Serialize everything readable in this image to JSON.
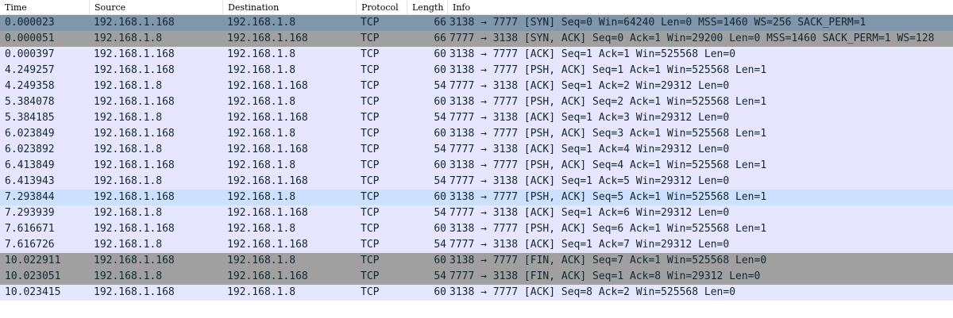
{
  "columns": {
    "time": "Time",
    "source": "Source",
    "destination": "Destination",
    "protocol": "Protocol",
    "length": "Length",
    "info": "Info"
  },
  "row_colors": {
    "default": "#e7e6ff",
    "syn_fin": "#a0a0a0",
    "selected": "#7f96ac",
    "hover": "#cde0ff"
  },
  "packets": [
    {
      "time": "0.000023",
      "source": "192.168.1.168",
      "destination": "192.168.1.8",
      "protocol": "TCP",
      "length": "66",
      "info": "3138 → 7777 [SYN] Seq=0 Win=64240 Len=0 MSS=1460 WS=256 SACK_PERM=1",
      "state": "selected"
    },
    {
      "time": "0.000051",
      "source": "192.168.1.8",
      "destination": "192.168.1.168",
      "protocol": "TCP",
      "length": "66",
      "info": "7777 → 3138 [SYN, ACK] Seq=0 Ack=1 Win=29200 Len=0 MSS=1460 SACK_PERM=1 WS=128",
      "state": "syn"
    },
    {
      "time": "0.000397",
      "source": "192.168.1.168",
      "destination": "192.168.1.8",
      "protocol": "TCP",
      "length": "60",
      "info": "3138 → 7777 [ACK] Seq=1 Ack=1 Win=525568 Len=0",
      "state": "default"
    },
    {
      "time": "4.249257",
      "source": "192.168.1.168",
      "destination": "192.168.1.8",
      "protocol": "TCP",
      "length": "60",
      "info": "3138 → 7777 [PSH, ACK] Seq=1 Ack=1 Win=525568 Len=1",
      "state": "default"
    },
    {
      "time": "4.249358",
      "source": "192.168.1.8",
      "destination": "192.168.1.168",
      "protocol": "TCP",
      "length": "54",
      "info": "7777 → 3138 [ACK] Seq=1 Ack=2 Win=29312 Len=0",
      "state": "default"
    },
    {
      "time": "5.384078",
      "source": "192.168.1.168",
      "destination": "192.168.1.8",
      "protocol": "TCP",
      "length": "60",
      "info": "3138 → 7777 [PSH, ACK] Seq=2 Ack=1 Win=525568 Len=1",
      "state": "default"
    },
    {
      "time": "5.384185",
      "source": "192.168.1.8",
      "destination": "192.168.1.168",
      "protocol": "TCP",
      "length": "54",
      "info": "7777 → 3138 [ACK] Seq=1 Ack=3 Win=29312 Len=0",
      "state": "default"
    },
    {
      "time": "6.023849",
      "source": "192.168.1.168",
      "destination": "192.168.1.8",
      "protocol": "TCP",
      "length": "60",
      "info": "3138 → 7777 [PSH, ACK] Seq=3 Ack=1 Win=525568 Len=1",
      "state": "default"
    },
    {
      "time": "6.023892",
      "source": "192.168.1.8",
      "destination": "192.168.1.168",
      "protocol": "TCP",
      "length": "54",
      "info": "7777 → 3138 [ACK] Seq=1 Ack=4 Win=29312 Len=0",
      "state": "default"
    },
    {
      "time": "6.413849",
      "source": "192.168.1.168",
      "destination": "192.168.1.8",
      "protocol": "TCP",
      "length": "60",
      "info": "3138 → 7777 [PSH, ACK] Seq=4 Ack=1 Win=525568 Len=1",
      "state": "default"
    },
    {
      "time": "6.413943",
      "source": "192.168.1.8",
      "destination": "192.168.1.168",
      "protocol": "TCP",
      "length": "54",
      "info": "7777 → 3138 [ACK] Seq=1 Ack=5 Win=29312 Len=0",
      "state": "default"
    },
    {
      "time": "7.293844",
      "source": "192.168.1.168",
      "destination": "192.168.1.8",
      "protocol": "TCP",
      "length": "60",
      "info": "3138 → 7777 [PSH, ACK] Seq=5 Ack=1 Win=525568 Len=1",
      "state": "hover"
    },
    {
      "time": "7.293939",
      "source": "192.168.1.8",
      "destination": "192.168.1.168",
      "protocol": "TCP",
      "length": "54",
      "info": "7777 → 3138 [ACK] Seq=1 Ack=6 Win=29312 Len=0",
      "state": "default"
    },
    {
      "time": "7.616671",
      "source": "192.168.1.168",
      "destination": "192.168.1.8",
      "protocol": "TCP",
      "length": "60",
      "info": "3138 → 7777 [PSH, ACK] Seq=6 Ack=1 Win=525568 Len=1",
      "state": "default"
    },
    {
      "time": "7.616726",
      "source": "192.168.1.8",
      "destination": "192.168.1.168",
      "protocol": "TCP",
      "length": "54",
      "info": "7777 → 3138 [ACK] Seq=1 Ack=7 Win=29312 Len=0",
      "state": "default"
    },
    {
      "time": "10.022911",
      "source": "192.168.1.168",
      "destination": "192.168.1.8",
      "protocol": "TCP",
      "length": "60",
      "info": "3138 → 7777 [FIN, ACK] Seq=7 Ack=1 Win=525568 Len=0",
      "state": "syn"
    },
    {
      "time": "10.023051",
      "source": "192.168.1.8",
      "destination": "192.168.1.168",
      "protocol": "TCP",
      "length": "54",
      "info": "7777 → 3138 [FIN, ACK] Seq=1 Ack=8 Win=29312 Len=0",
      "state": "syn"
    },
    {
      "time": "10.023415",
      "source": "192.168.1.168",
      "destination": "192.168.1.8",
      "protocol": "TCP",
      "length": "60",
      "info": "3138 → 7777 [ACK] Seq=8 Ack=2 Win=525568 Len=0",
      "state": "default"
    }
  ]
}
